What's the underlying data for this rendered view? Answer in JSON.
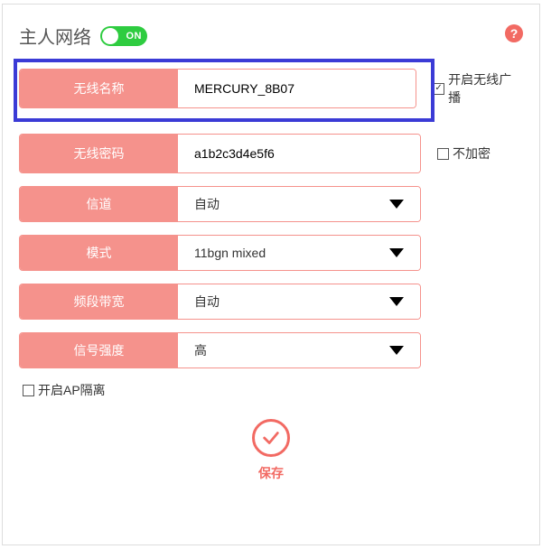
{
  "header": {
    "title": "主人网络",
    "toggle_label": "ON"
  },
  "rows": {
    "ssid": {
      "label": "无线名称",
      "value": "MERCURY_8B07"
    },
    "password": {
      "label": "无线密码",
      "value": "a1b2c3d4e5f6"
    },
    "channel": {
      "label": "信道",
      "value": "自动"
    },
    "mode": {
      "label": "模式",
      "value": "11bgn mixed"
    },
    "bandwidth": {
      "label": "频段带宽",
      "value": "自动"
    },
    "strength": {
      "label": "信号强度",
      "value": "高"
    }
  },
  "checks": {
    "broadcast": {
      "label": "开启无线广播",
      "checked": "✓"
    },
    "noencrypt": {
      "label": "不加密",
      "checked": ""
    },
    "apisolate": {
      "label": "开启AP隔离",
      "checked": ""
    }
  },
  "save_label": "保存"
}
